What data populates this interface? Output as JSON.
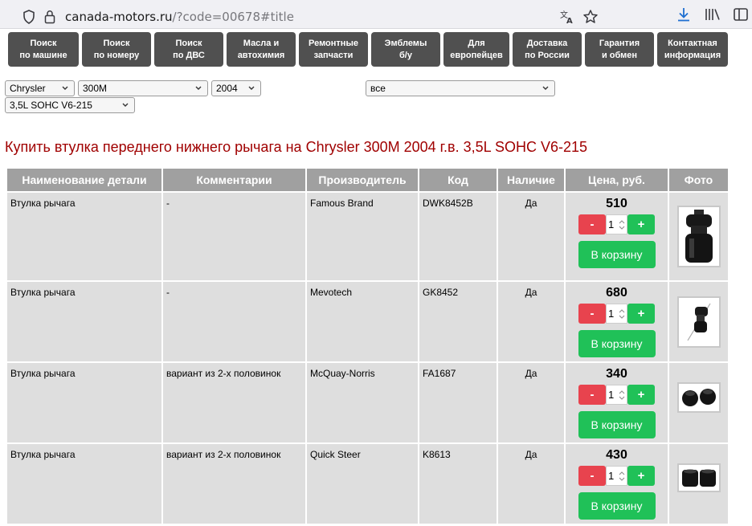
{
  "browser": {
    "url_host": "canada-motors.ru",
    "url_rest": "/?code=00678#title"
  },
  "nav": [
    {
      "line1": "Поиск",
      "line2": "по машине"
    },
    {
      "line1": "Поиск",
      "line2": "по номеру"
    },
    {
      "line1": "Поиск",
      "line2": "по ДВС"
    },
    {
      "line1": "Масла и",
      "line2": "автохимия"
    },
    {
      "line1": "Ремонтные",
      "line2": "запчасти"
    },
    {
      "line1": "Эмблемы",
      "line2": "б/у"
    },
    {
      "line1": "Для",
      "line2": "европейцев"
    },
    {
      "line1": "Доставка",
      "line2": "по России"
    },
    {
      "line1": "Гарантия",
      "line2": "и обмен"
    },
    {
      "line1": "Контактная",
      "line2": "информация"
    }
  ],
  "filters": {
    "make": "Chrysler",
    "model": "300M",
    "year": "2004",
    "engine": "3,5L SOHC V6-215",
    "category": "все"
  },
  "page_title": "Купить втулка переднего нижнего рычага на Chrysler 300M 2004 г.в. 3,5L SOHC V6-215",
  "table": {
    "headers": [
      "Наименование детали",
      "Комментарии",
      "Производитель",
      "Код",
      "Наличие",
      "Цена, руб.",
      "Фото"
    ],
    "cart_label": "В корзину",
    "minus_label": "-",
    "plus_label": "+",
    "rows": [
      {
        "name": "Втулка рычага",
        "comment": "-",
        "maker": "Famous Brand",
        "code": "DWK8452B",
        "avail": "Да",
        "price": "510",
        "qty": "1"
      },
      {
        "name": "Втулка рычага",
        "comment": "-",
        "maker": "Mevotech",
        "code": "GK8452",
        "avail": "Да",
        "price": "680",
        "qty": "1"
      },
      {
        "name": "Втулка рычага",
        "comment": "вариант из 2-х половинок",
        "maker": "McQuay-Norris",
        "code": "FA1687",
        "avail": "Да",
        "price": "340",
        "qty": "1"
      },
      {
        "name": "Втулка рычага",
        "comment": "вариант из 2-х половинок",
        "maker": "Quick Steer",
        "code": "K8613",
        "avail": "Да",
        "price": "430",
        "qty": "1"
      }
    ]
  },
  "colors": {
    "nav_bg": "#505050",
    "title_red": "#a00000",
    "header_gray": "#a0a0a0",
    "cell_gray": "#dedede",
    "btn_green": "#20c158",
    "btn_red": "#e8434e"
  }
}
